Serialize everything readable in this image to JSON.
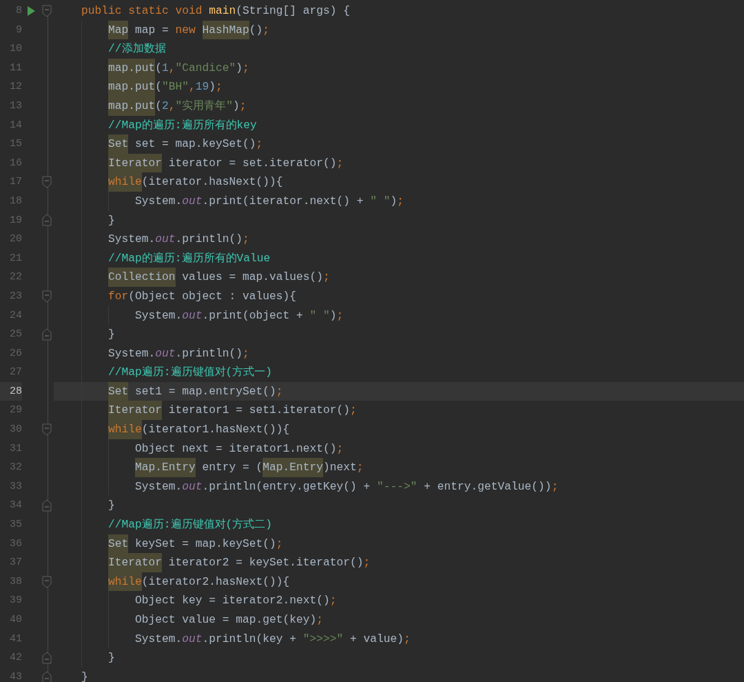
{
  "editor": {
    "lines": [
      {
        "number": "8",
        "selected": false,
        "markers": [
          {
            "kind": "run"
          },
          {
            "kind": "fold-start"
          }
        ],
        "tokens": [
          {
            "text": "public static void ",
            "kind": "keyword"
          },
          {
            "text": "main",
            "kind": "method"
          },
          {
            "text": "(String[] args) {",
            "kind": "plain"
          }
        ],
        "children": [
          {
            "number": "9",
            "selected": false,
            "tokens": [
              {
                "text": "Map",
                "kind": "usage"
              },
              {
                "text": " map = ",
                "kind": "plain"
              },
              {
                "text": "new ",
                "kind": "keyword"
              },
              {
                "text": "HashMap",
                "kind": "usage"
              },
              {
                "text": "()",
                "kind": "plain"
              },
              {
                "text": ";",
                "kind": "punct"
              }
            ]
          },
          {
            "number": "10",
            "selected": false,
            "tokens": [
              {
                "text": "//添加数据",
                "kind": "comment"
              }
            ]
          },
          {
            "number": "11",
            "selected": false,
            "tokens": [
              {
                "text": "map.put",
                "kind": "usage"
              },
              {
                "text": "(",
                "kind": "plain"
              },
              {
                "text": "1",
                "kind": "number"
              },
              {
                "text": ",",
                "kind": "punct"
              },
              {
                "text": "\"Candice\"",
                "kind": "string"
              },
              {
                "text": ")",
                "kind": "plain"
              },
              {
                "text": ";",
                "kind": "punct"
              }
            ]
          },
          {
            "number": "12",
            "selected": false,
            "tokens": [
              {
                "text": "map.put",
                "kind": "usage"
              },
              {
                "text": "(",
                "kind": "plain"
              },
              {
                "text": "\"BH\"",
                "kind": "string"
              },
              {
                "text": ",",
                "kind": "punct"
              },
              {
                "text": "19",
                "kind": "number"
              },
              {
                "text": ")",
                "kind": "plain"
              },
              {
                "text": ";",
                "kind": "punct"
              }
            ]
          },
          {
            "number": "13",
            "selected": false,
            "tokens": [
              {
                "text": "map.put",
                "kind": "usage"
              },
              {
                "text": "(",
                "kind": "plain"
              },
              {
                "text": "2",
                "kind": "number"
              },
              {
                "text": ",",
                "kind": "punct"
              },
              {
                "text": "\"实用青年\"",
                "kind": "string"
              },
              {
                "text": ")",
                "kind": "plain"
              },
              {
                "text": ";",
                "kind": "punct"
              }
            ]
          },
          {
            "number": "14",
            "selected": false,
            "tokens": [
              {
                "text": "//Map的遍历:遍历所有的key",
                "kind": "comment"
              }
            ]
          },
          {
            "number": "15",
            "selected": false,
            "tokens": [
              {
                "text": "Set",
                "kind": "usage"
              },
              {
                "text": " set = map.keySet()",
                "kind": "plain"
              },
              {
                "text": ";",
                "kind": "punct"
              }
            ]
          },
          {
            "number": "16",
            "selected": false,
            "tokens": [
              {
                "text": "Iterator",
                "kind": "usage"
              },
              {
                "text": " iterator = set.iterator()",
                "kind": "plain"
              },
              {
                "text": ";",
                "kind": "punct"
              }
            ]
          },
          {
            "number": "17",
            "selected": false,
            "markers": [
              {
                "kind": "fold-start"
              }
            ],
            "tokens": [
              {
                "text": "while",
                "kind": "usage-keyword"
              },
              {
                "text": "(iterator.hasNext()){",
                "kind": "plain"
              }
            ],
            "children": [
              {
                "number": "18",
                "selected": false,
                "tokens": [
                  {
                    "text": "System.",
                    "kind": "plain"
                  },
                  {
                    "text": "out",
                    "kind": "field"
                  },
                  {
                    "text": ".print(iterator.next() + ",
                    "kind": "plain"
                  },
                  {
                    "text": "\" \"",
                    "kind": "string"
                  },
                  {
                    "text": ")",
                    "kind": "plain"
                  },
                  {
                    "text": ";",
                    "kind": "punct"
                  }
                ]
              }
            ]
          },
          {
            "number": "19",
            "selected": false,
            "markers": [
              {
                "kind": "fold-end"
              }
            ],
            "tokens": [
              {
                "text": "}",
                "kind": "plain"
              }
            ]
          },
          {
            "number": "20",
            "selected": false,
            "tokens": [
              {
                "text": "System.",
                "kind": "plain"
              },
              {
                "text": "out",
                "kind": "field"
              },
              {
                "text": ".println()",
                "kind": "plain"
              },
              {
                "text": ";",
                "kind": "punct"
              }
            ]
          },
          {
            "number": "21",
            "selected": false,
            "tokens": [
              {
                "text": "//Map的遍历:遍历所有的Value",
                "kind": "comment"
              }
            ]
          },
          {
            "number": "22",
            "selected": false,
            "tokens": [
              {
                "text": "Collection",
                "kind": "usage"
              },
              {
                "text": " values = map.values()",
                "kind": "plain"
              },
              {
                "text": ";",
                "kind": "punct"
              }
            ]
          },
          {
            "number": "23",
            "selected": false,
            "markers": [
              {
                "kind": "fold-start"
              }
            ],
            "tokens": [
              {
                "text": "for",
                "kind": "keyword"
              },
              {
                "text": "(Object object : values){",
                "kind": "plain"
              }
            ],
            "children": [
              {
                "number": "24",
                "selected": false,
                "tokens": [
                  {
                    "text": "System.",
                    "kind": "plain"
                  },
                  {
                    "text": "out",
                    "kind": "field"
                  },
                  {
                    "text": ".print(object + ",
                    "kind": "plain"
                  },
                  {
                    "text": "\" \"",
                    "kind": "string"
                  },
                  {
                    "text": ")",
                    "kind": "plain"
                  },
                  {
                    "text": ";",
                    "kind": "punct"
                  }
                ]
              }
            ]
          },
          {
            "number": "25",
            "selected": false,
            "markers": [
              {
                "kind": "fold-end"
              }
            ],
            "tokens": [
              {
                "text": "}",
                "kind": "plain"
              }
            ]
          },
          {
            "number": "26",
            "selected": false,
            "tokens": [
              {
                "text": "System.",
                "kind": "plain"
              },
              {
                "text": "out",
                "kind": "field"
              },
              {
                "text": ".println()",
                "kind": "plain"
              },
              {
                "text": ";",
                "kind": "punct"
              }
            ]
          },
          {
            "number": "27",
            "selected": false,
            "tokens": [
              {
                "text": "//Map遍历:遍历键值对(方式一)",
                "kind": "comment"
              }
            ]
          },
          {
            "number": "28",
            "selected": true,
            "tokens": [
              {
                "text": "Set",
                "kind": "usage"
              },
              {
                "text": " set1 = map.entrySet()",
                "kind": "plain"
              },
              {
                "text": ";",
                "kind": "punct"
              }
            ]
          },
          {
            "number": "29",
            "selected": false,
            "tokens": [
              {
                "text": "Iterator",
                "kind": "usage"
              },
              {
                "text": " iterator1 = set1.iterator()",
                "kind": "plain"
              },
              {
                "text": ";",
                "kind": "punct"
              }
            ]
          },
          {
            "number": "30",
            "selected": false,
            "markers": [
              {
                "kind": "fold-start"
              }
            ],
            "tokens": [
              {
                "text": "while",
                "kind": "usage-keyword"
              },
              {
                "text": "(iterator1.hasNext()){",
                "kind": "plain"
              }
            ],
            "children": [
              {
                "number": "31",
                "selected": false,
                "tokens": [
                  {
                    "text": "Object next = iterator1.next()",
                    "kind": "plain"
                  },
                  {
                    "text": ";",
                    "kind": "punct"
                  }
                ]
              },
              {
                "number": "32",
                "selected": false,
                "tokens": [
                  {
                    "text": "Map.Entry",
                    "kind": "usage"
                  },
                  {
                    "text": " entry = (",
                    "kind": "plain"
                  },
                  {
                    "text": "Map.Entry",
                    "kind": "usage"
                  },
                  {
                    "text": ")next",
                    "kind": "plain"
                  },
                  {
                    "text": ";",
                    "kind": "punct"
                  }
                ]
              },
              {
                "number": "33",
                "selected": false,
                "tokens": [
                  {
                    "text": "System.",
                    "kind": "plain"
                  },
                  {
                    "text": "out",
                    "kind": "field"
                  },
                  {
                    "text": ".println(entry.getKey() + ",
                    "kind": "plain"
                  },
                  {
                    "text": "\"--->\"",
                    "kind": "string"
                  },
                  {
                    "text": " + entry.getValue())",
                    "kind": "plain"
                  },
                  {
                    "text": ";",
                    "kind": "punct"
                  }
                ]
              }
            ]
          },
          {
            "number": "34",
            "selected": false,
            "markers": [
              {
                "kind": "fold-end"
              }
            ],
            "tokens": [
              {
                "text": "}",
                "kind": "plain"
              }
            ]
          },
          {
            "number": "35",
            "selected": false,
            "tokens": [
              {
                "text": "//Map遍历:遍历键值对(方式二)",
                "kind": "comment"
              }
            ]
          },
          {
            "number": "36",
            "selected": false,
            "tokens": [
              {
                "text": "Set",
                "kind": "usage"
              },
              {
                "text": " keySet = map.keySet()",
                "kind": "plain"
              },
              {
                "text": ";",
                "kind": "punct"
              }
            ]
          },
          {
            "number": "37",
            "selected": false,
            "tokens": [
              {
                "text": "Iterator",
                "kind": "usage"
              },
              {
                "text": " iterator2 = keySet.iterator()",
                "kind": "plain"
              },
              {
                "text": ";",
                "kind": "punct"
              }
            ]
          },
          {
            "number": "38",
            "selected": false,
            "markers": [
              {
                "kind": "fold-start"
              }
            ],
            "tokens": [
              {
                "text": "while",
                "kind": "usage-keyword"
              },
              {
                "text": "(iterator2.hasNext()){",
                "kind": "plain"
              }
            ],
            "children": [
              {
                "number": "39",
                "selected": false,
                "tokens": [
                  {
                    "text": "Object key = iterator2.next()",
                    "kind": "plain"
                  },
                  {
                    "text": ";",
                    "kind": "punct"
                  }
                ]
              },
              {
                "number": "40",
                "selected": false,
                "tokens": [
                  {
                    "text": "Object value = map.get(key)",
                    "kind": "plain"
                  },
                  {
                    "text": ";",
                    "kind": "punct"
                  }
                ]
              },
              {
                "number": "41",
                "selected": false,
                "tokens": [
                  {
                    "text": "System.",
                    "kind": "plain"
                  },
                  {
                    "text": "out",
                    "kind": "field"
                  },
                  {
                    "text": ".println(key + ",
                    "kind": "plain"
                  },
                  {
                    "text": "\">>>>\"",
                    "kind": "string"
                  },
                  {
                    "text": " + value)",
                    "kind": "plain"
                  },
                  {
                    "text": ";",
                    "kind": "punct"
                  }
                ]
              }
            ]
          },
          {
            "number": "42",
            "selected": false,
            "markers": [
              {
                "kind": "fold-end"
              }
            ],
            "tokens": [
              {
                "text": "}",
                "kind": "plain"
              }
            ]
          }
        ]
      },
      {
        "number": "43",
        "selected": false,
        "markers": [
          {
            "kind": "fold-end"
          }
        ],
        "tokens": [
          {
            "text": "}",
            "kind": "plain"
          }
        ]
      }
    ]
  }
}
